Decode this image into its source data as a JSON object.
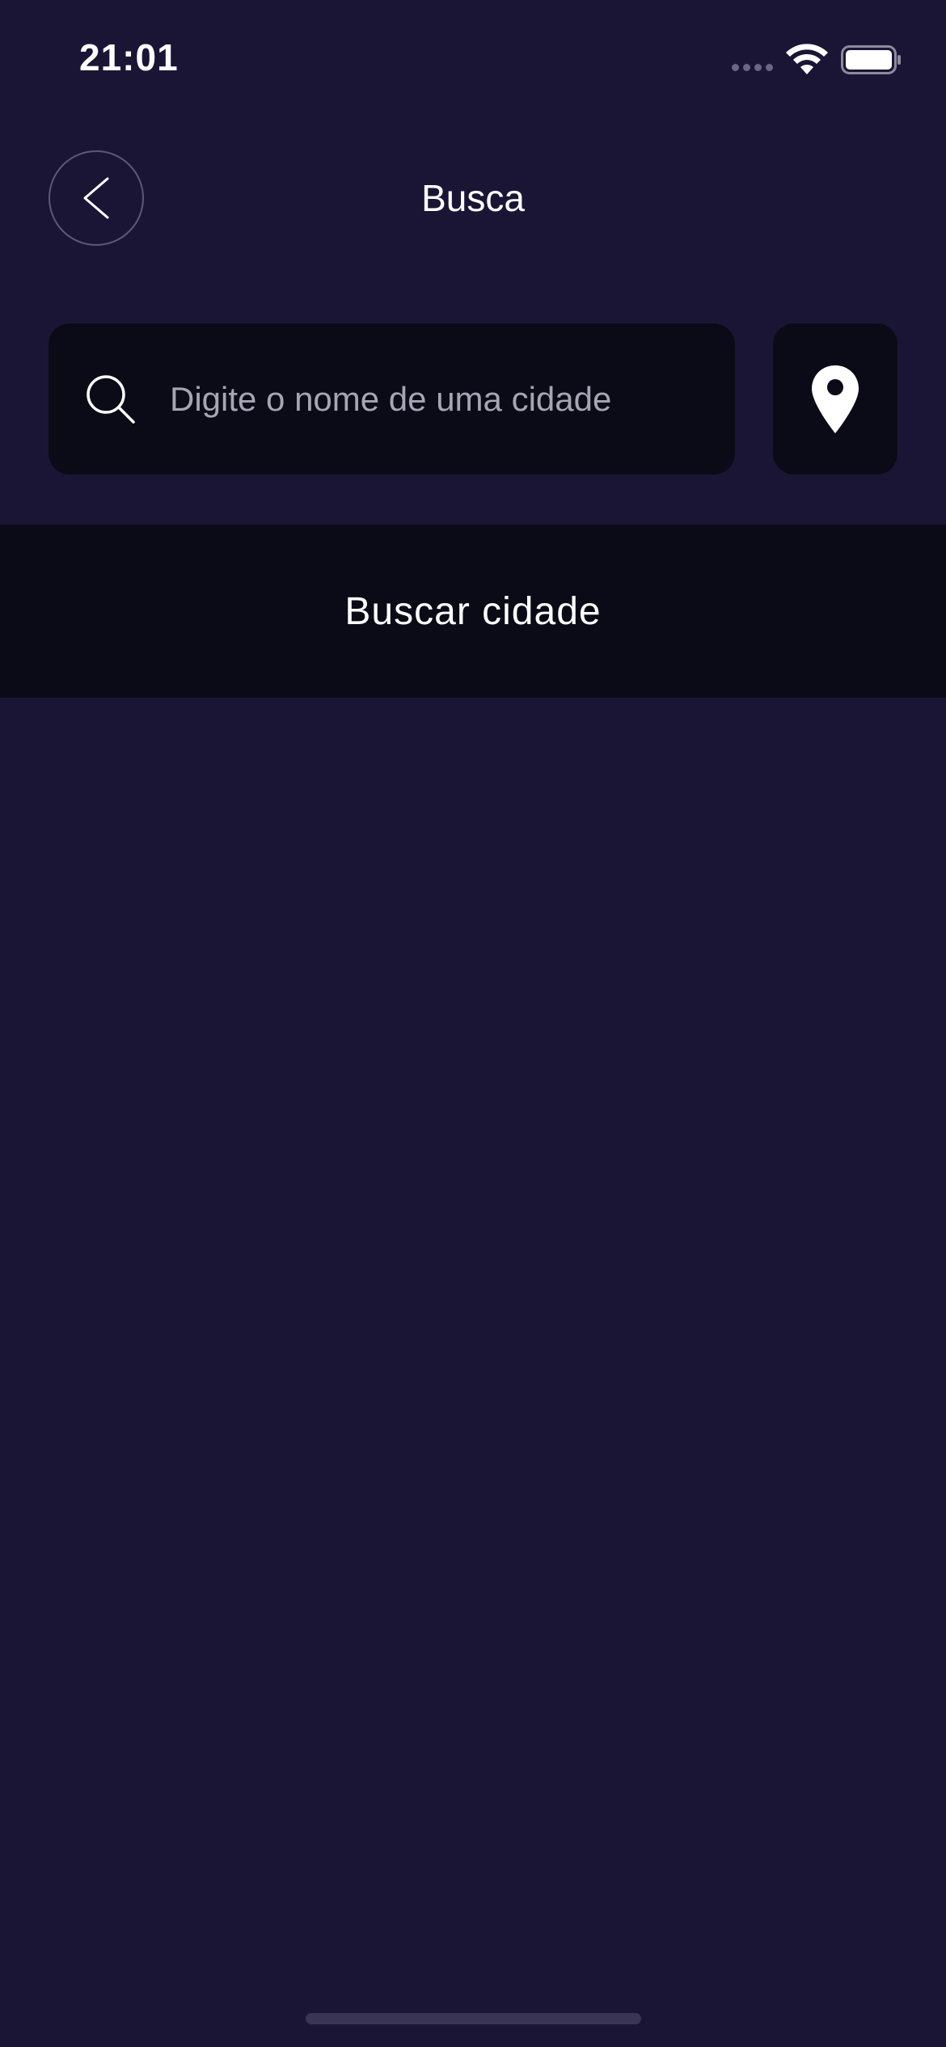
{
  "status_bar": {
    "time": "21:01"
  },
  "header": {
    "title": "Busca",
    "back_icon": "chevron-left-icon"
  },
  "search": {
    "placeholder": "Digite o nome de uma cidade",
    "value": "",
    "icon": "search-icon"
  },
  "location_button": {
    "icon": "map-pin-icon"
  },
  "search_city_button": {
    "label": "Buscar cidade"
  },
  "colors": {
    "background": "#1b1535",
    "surface": "#0b0a17",
    "placeholder": "#a7a5b4",
    "text": "#ffffff"
  }
}
